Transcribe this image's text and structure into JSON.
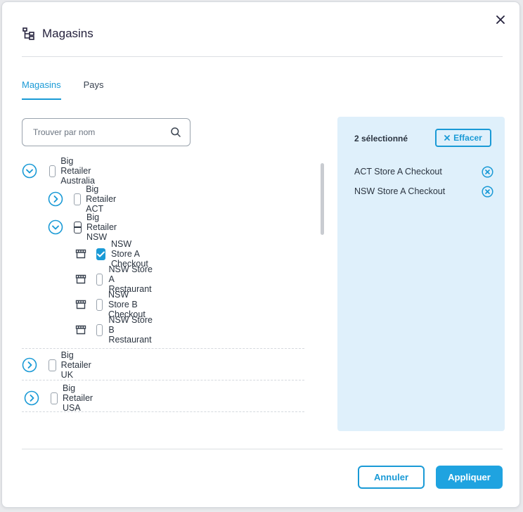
{
  "dialog": {
    "title": "Magasins",
    "title_icon": "hierarchy-icon"
  },
  "tabs": [
    {
      "label": "Magasins",
      "active": true
    },
    {
      "label": "Pays",
      "active": false
    }
  ],
  "search": {
    "placeholder": "Trouver par nom",
    "value": ""
  },
  "tree": {
    "australia": {
      "label": "Big Retailer Australia",
      "expanded": true,
      "state": "unchecked"
    },
    "act": {
      "label": "Big Retailer ACT",
      "expanded": false,
      "state": "unchecked"
    },
    "nsw": {
      "label": "Big Retailer NSW",
      "expanded": true,
      "state": "partial"
    },
    "stores": [
      {
        "label": "NSW Store A Checkout",
        "checked": true
      },
      {
        "label": "NSW Store A Restaurant",
        "checked": false
      },
      {
        "label": "NSW Store B Checkout",
        "checked": false
      },
      {
        "label": "NSW Store B Restaurant",
        "checked": false
      }
    ],
    "uk": {
      "label": "Big Retailer UK",
      "expanded": false,
      "state": "unchecked"
    },
    "usa": {
      "label": "Big Retailer USA",
      "expanded": false,
      "state": "unchecked"
    }
  },
  "selection": {
    "count_label": "2 sélectionné",
    "clear_label": "Effacer",
    "items": [
      "ACT Store A Checkout",
      "NSW Store A Checkout"
    ]
  },
  "footer": {
    "cancel_label": "Annuler",
    "apply_label": "Appliquer"
  },
  "colors": {
    "accent": "#1a9ad6",
    "panel_bg": "#dff0fb",
    "title": "#25223d"
  }
}
